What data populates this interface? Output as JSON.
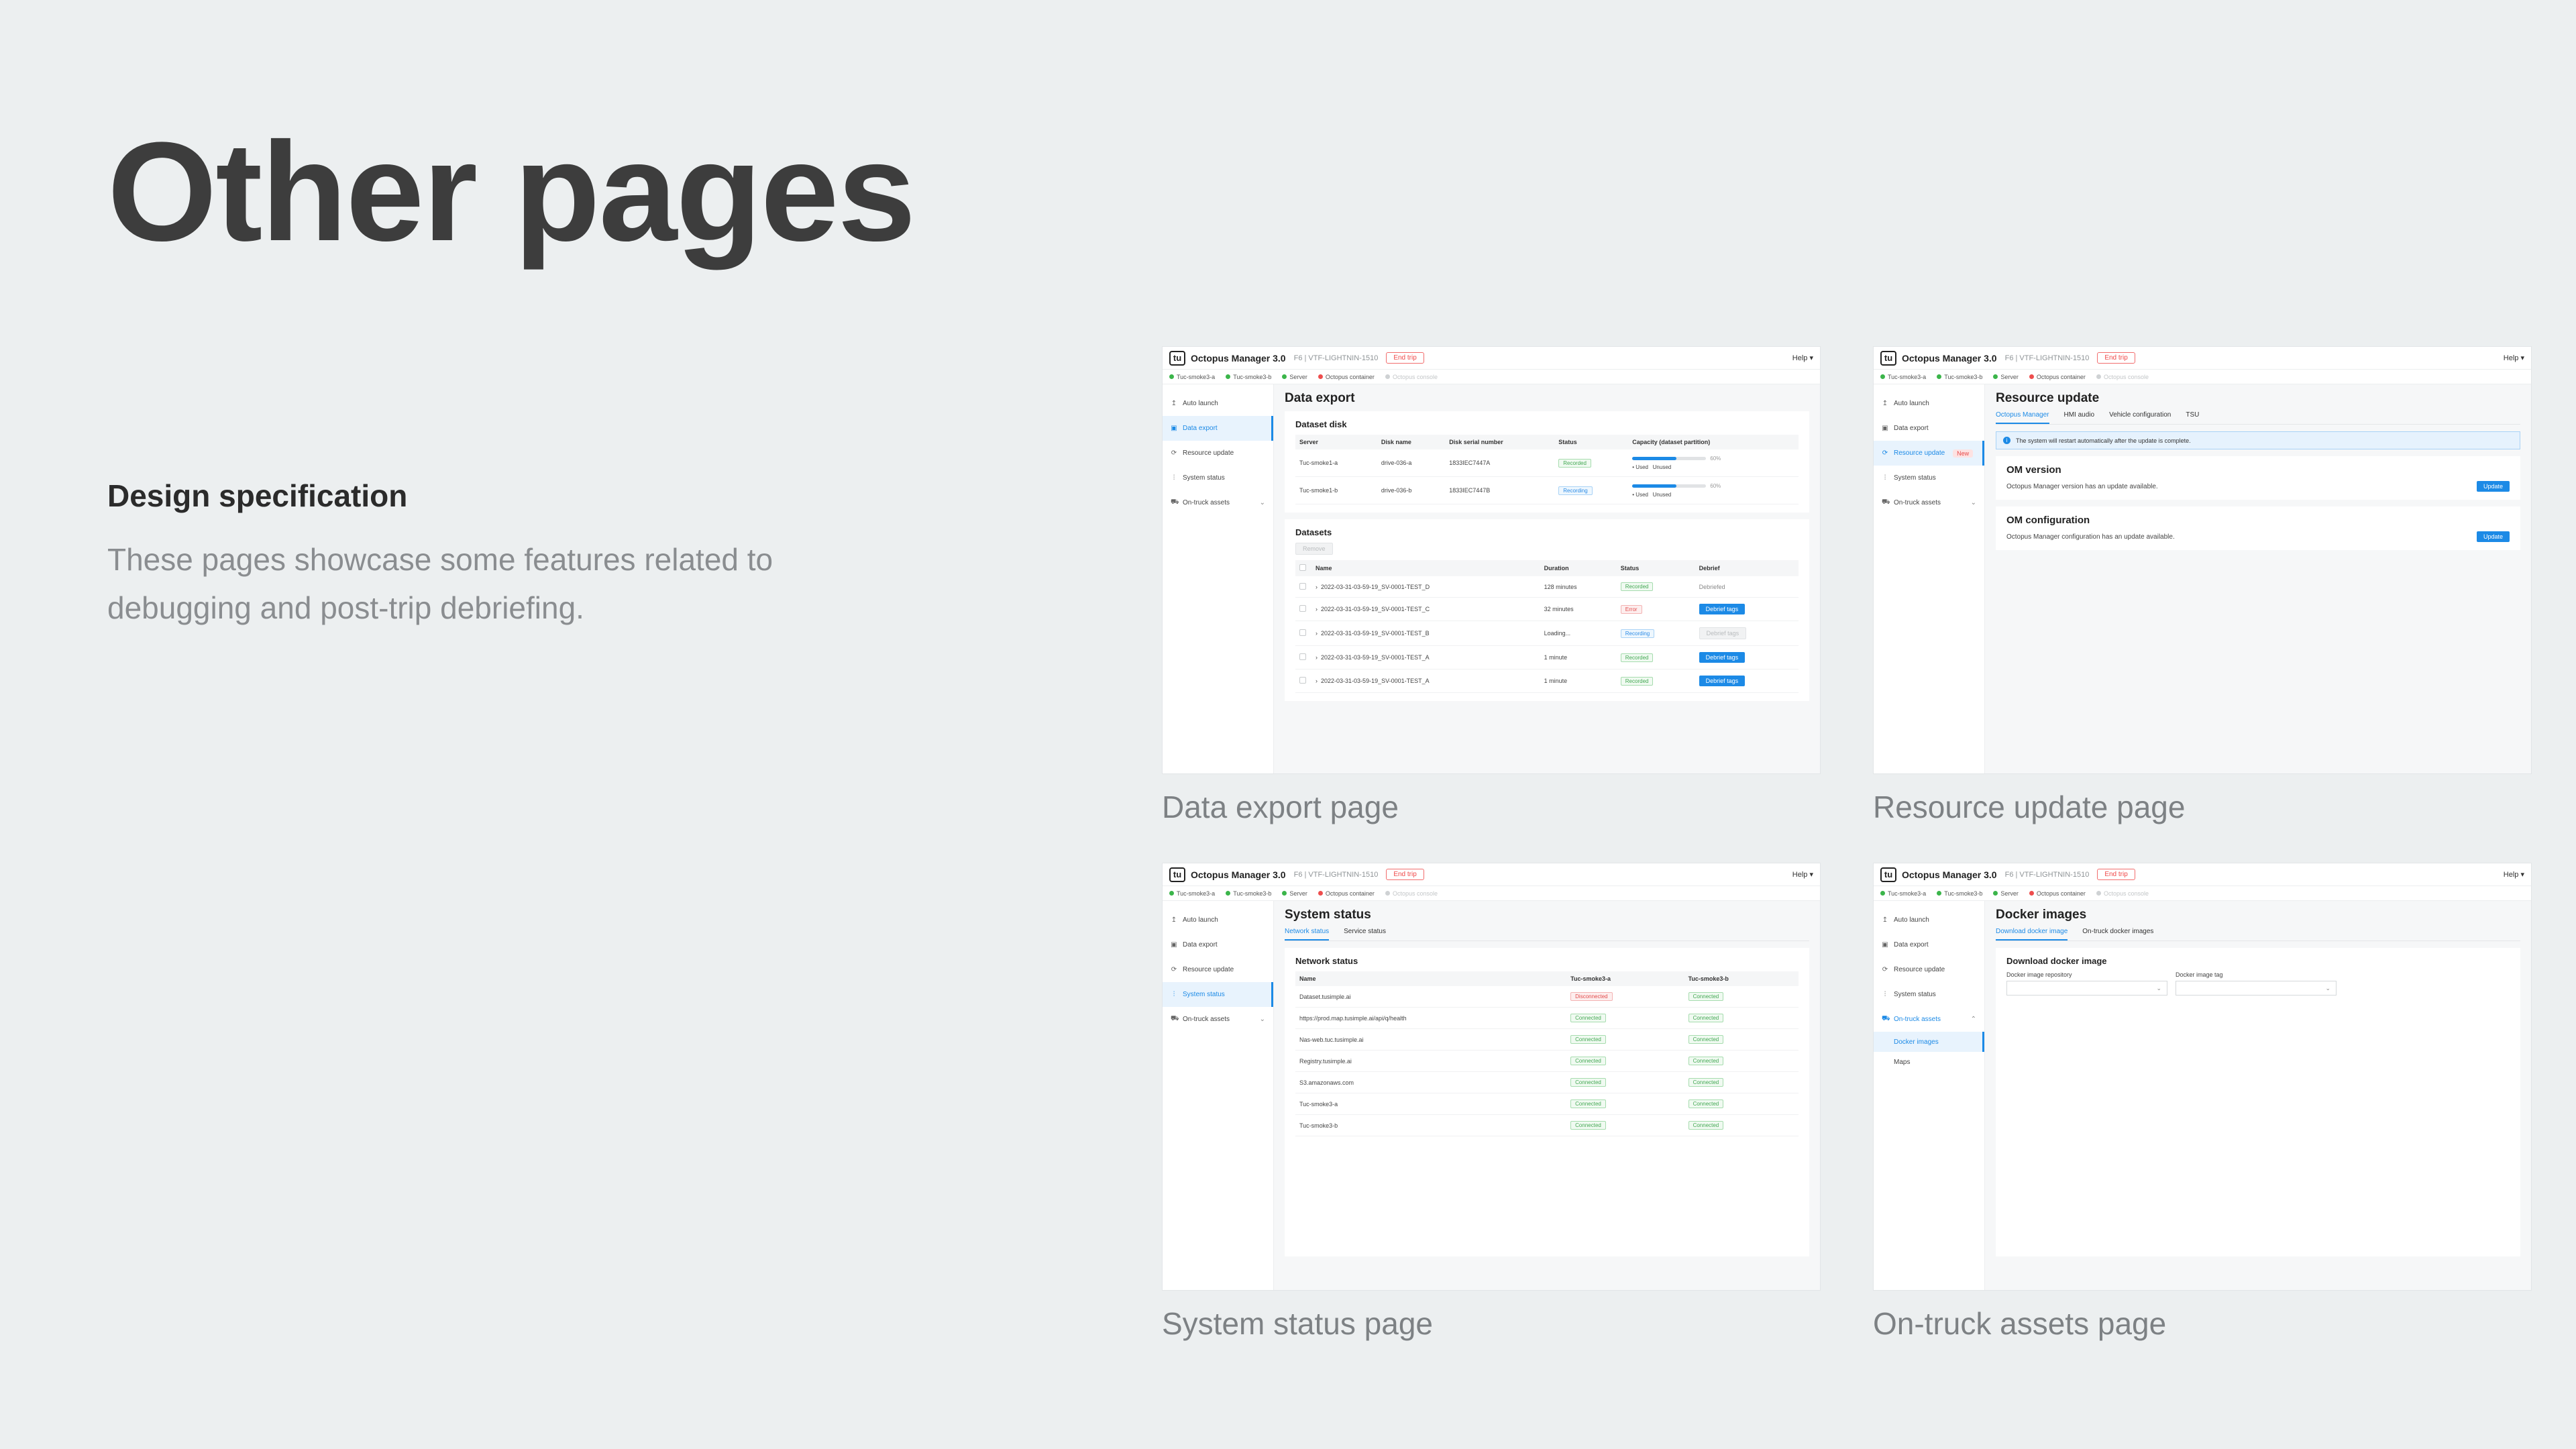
{
  "heading": "Other pages",
  "spec": {
    "title": "Design specification",
    "description": "These pages showcase some features related to debugging and post-trip debriefing."
  },
  "app": {
    "name": "Octopus Manager 3.0",
    "truck_id": "F6 | VTF-LIGHTNIN-1510",
    "end_trip": "End trip",
    "help": "Help ▾",
    "status": [
      "Tuc-smoke3-a",
      "Tuc-smoke3-b",
      "Server",
      "Octopus container",
      "Octopus console"
    ]
  },
  "nav": {
    "auto_launch": "Auto launch",
    "data_export": "Data export",
    "resource_update": "Resource update",
    "system_status": "System status",
    "on_truck_assets": "On-truck assets",
    "new_badge": "New",
    "docker_images": "Docker images",
    "maps": "Maps"
  },
  "captions": {
    "data_export": "Data export page",
    "resource_update": "Resource update page",
    "system_status": "System status page",
    "on_truck_assets": "On-truck assets page"
  },
  "data_export": {
    "title": "Data export",
    "disk_title": "Dataset disk",
    "disk_headers": [
      "Server",
      "Disk name",
      "Disk serial number",
      "Status",
      "Capacity (dataset partition)"
    ],
    "disks": [
      {
        "server": "Tuc-smoke1-a",
        "disk": "drive-036-a",
        "serial": "1833IEC7447A",
        "status": "Recorded",
        "pct": 0.6,
        "pct_label": "60%"
      },
      {
        "server": "Tuc-smoke1-b",
        "disk": "drive-036-b",
        "serial": "1833IEC7447B",
        "status": "Recording",
        "pct": 0.6,
        "pct_label": "60%"
      }
    ],
    "legend_used": "• Used",
    "legend_unused": "Unused",
    "datasets_title": "Datasets",
    "remove": "Remove",
    "dataset_headers": [
      "Name",
      "Duration",
      "Status",
      "Debrief"
    ],
    "datasets": [
      {
        "name": "2022-03-31-03-59-19_SV-0001-TEST_D",
        "duration": "128 minutes",
        "status": "Recorded",
        "debrief": "Debriefed"
      },
      {
        "name": "2022-03-31-03-59-19_SV-0001-TEST_C",
        "duration": "32 minutes",
        "status": "Error",
        "debrief": "Debrief tags"
      },
      {
        "name": "2022-03-31-03-59-19_SV-0001-TEST_B",
        "duration": "Loading...",
        "status": "Recording",
        "debrief": "Debrief tags"
      },
      {
        "name": "2022-03-31-03-59-19_SV-0001-TEST_A",
        "duration": "1 minute",
        "status": "Recorded",
        "debrief": "Debrief tags"
      },
      {
        "name": "2022-03-31-03-59-19_SV-0001-TEST_A",
        "duration": "1 minute",
        "status": "Recorded",
        "debrief": "Debrief tags"
      }
    ]
  },
  "resource_update": {
    "title": "Resource update",
    "tabs": [
      "Octopus Manager",
      "HMI audio",
      "Vehicle configuration",
      "TSU"
    ],
    "banner": "The system will restart automatically after the update is complete.",
    "om_version_title": "OM version",
    "om_version_text": "Octopus Manager version has an update available.",
    "om_config_title": "OM configuration",
    "om_config_text": "Octopus Manager configuration has an update available.",
    "update": "Update"
  },
  "system_status": {
    "title": "System status",
    "tabs": [
      "Network status",
      "Service status"
    ],
    "card_title": "Network status",
    "headers": [
      "Name",
      "Tuc-smoke3-a",
      "Tuc-smoke3-b"
    ],
    "rows": [
      {
        "name": "Dataset.tusimple.ai",
        "a": "Disconnected",
        "b": "Connected"
      },
      {
        "name": "https://prod.map.tusimple.ai/api/q/health",
        "a": "Connected",
        "b": "Connected"
      },
      {
        "name": "Nas-web.tuc.tusimple.ai",
        "a": "Connected",
        "b": "Connected"
      },
      {
        "name": "Registry.tusimple.ai",
        "a": "Connected",
        "b": "Connected"
      },
      {
        "name": "S3.amazonaws.com",
        "a": "Connected",
        "b": "Connected"
      },
      {
        "name": "Tuc-smoke3-a",
        "a": "Connected",
        "b": "Connected"
      },
      {
        "name": "Tuc-smoke3-b",
        "a": "Connected",
        "b": "Connected"
      }
    ]
  },
  "docker": {
    "title": "Docker images",
    "tabs": [
      "Download docker image",
      "On-truck docker images"
    ],
    "card_title": "Download docker image",
    "repo_label": "Docker image repository",
    "tag_label": "Docker image tag"
  }
}
